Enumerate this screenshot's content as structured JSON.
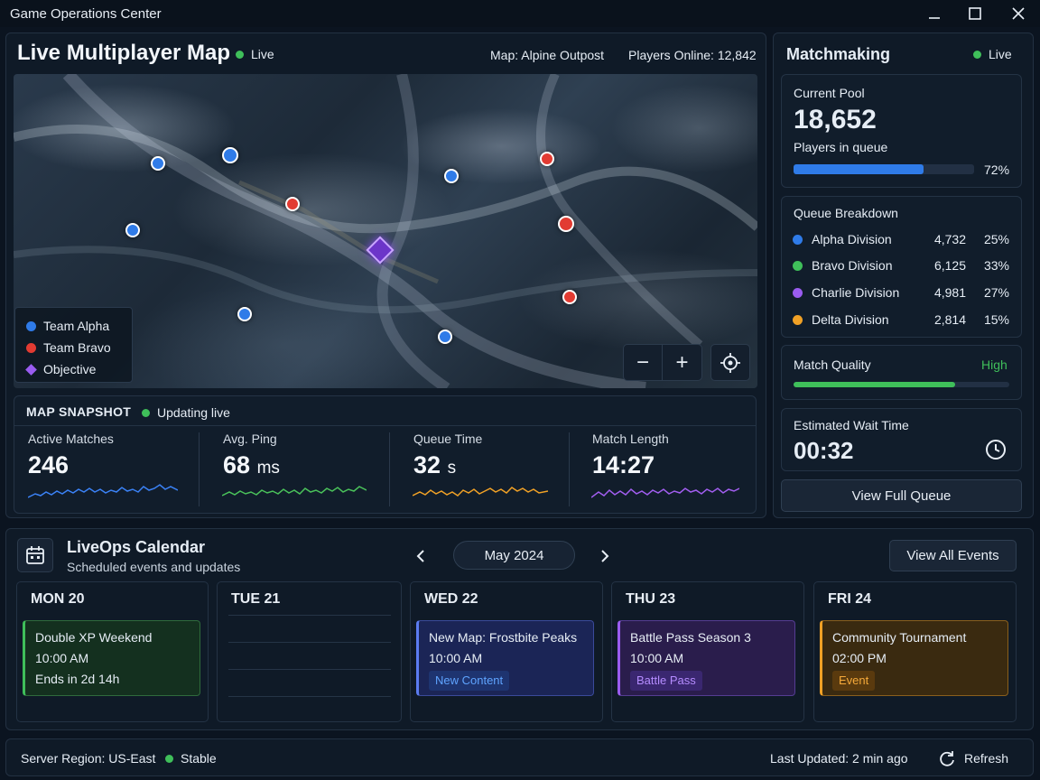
{
  "window": {
    "title": "Game Operations Center"
  },
  "map_panel": {
    "title": "Live Multiplayer Map",
    "status": "Live",
    "map_name": "Map: Alpine Outpost",
    "players_online": "Players Online: 12,842",
    "legend": [
      {
        "label": "Team Alpha",
        "color": "#2f7be8"
      },
      {
        "label": "Team Bravo",
        "color": "#e23b32"
      },
      {
        "label": "Objective",
        "color": "#9a5cf0"
      }
    ],
    "zoom_out": "−",
    "zoom_in": "+"
  },
  "snapshot": {
    "title": "MAP SNAPSHOT",
    "status": "Updating live",
    "stats": [
      {
        "label": "Active Matches",
        "value": "246",
        "unit": "",
        "color": "#3b82f6"
      },
      {
        "label": "Avg. Ping",
        "value": "68",
        "unit": "ms",
        "color": "#4ac25a"
      },
      {
        "label": "Queue Time",
        "value": "32",
        "unit": "s",
        "color": "#f0a126"
      },
      {
        "label": "Match Length",
        "value": "14:27",
        "unit": "",
        "color": "#a25ef0"
      }
    ]
  },
  "matchmaking": {
    "title": "Matchmaking",
    "status": "Live",
    "pool": {
      "label": "Current Pool",
      "value": "18,652",
      "sub": "Players in queue",
      "percent_text": "72%",
      "percent": 0.72
    },
    "breakdown": {
      "title": "Queue Breakdown",
      "rows": [
        {
          "name": "Alpha Division",
          "count": "4,732",
          "pct": "25%",
          "color": "#2f7be8"
        },
        {
          "name": "Bravo Division",
          "count": "6,125",
          "pct": "33%",
          "color": "#3fbf5a"
        },
        {
          "name": "Charlie Division",
          "count": "4,981",
          "pct": "27%",
          "color": "#9a5cf0"
        },
        {
          "name": "Delta Division",
          "count": "2,814",
          "pct": "15%",
          "color": "#f0a126"
        }
      ]
    },
    "quality": {
      "label": "Match Quality",
      "value": "High",
      "level": 0.75
    },
    "wait": {
      "label": "Estimated Wait Time",
      "value": "00:32"
    },
    "view_queue": "View Full Queue"
  },
  "calendar": {
    "title": "LiveOps Calendar",
    "subtitle": "Scheduled events and updates",
    "month": "May 2024",
    "view_all": "View All Events",
    "days": [
      {
        "label": "MON 20",
        "event": {
          "title": "Double XP Weekend",
          "time": "10:00 AM",
          "extra": "Ends in 2d 14h"
        }
      },
      {
        "label": "TUE 21"
      },
      {
        "label": "WED 22",
        "event": {
          "title": "New Map: Frostbite Peaks",
          "time": "10:00 AM",
          "tag": "New Content"
        }
      },
      {
        "label": "THU 23",
        "event": {
          "title": "Battle Pass Season 3",
          "time": "10:00 AM",
          "tag": "Battle Pass"
        }
      },
      {
        "label": "FRI 24",
        "event": {
          "title": "Community Tournament",
          "time": "02:00 PM",
          "tag": "Event"
        }
      }
    ]
  },
  "footer": {
    "region": "Server Region: US-East",
    "status": "Stable",
    "updated": "Last Updated: 2 min ago",
    "refresh": "Refresh"
  }
}
